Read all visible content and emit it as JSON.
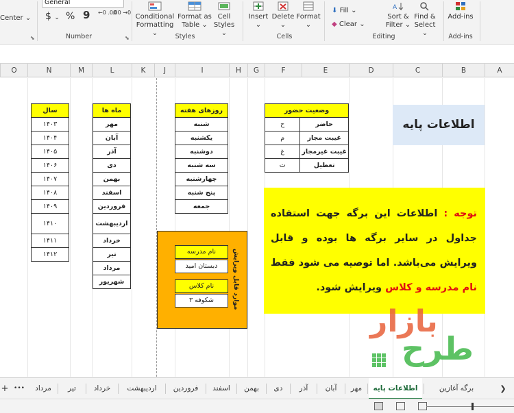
{
  "ribbon": {
    "alignment": {
      "merge_label": "Center"
    },
    "number": {
      "format_value": "General",
      "currency_symbol": "$",
      "percent_symbol": "%",
      "comma_symbol": "9",
      "increase_decimal": "←0 .00",
      "decrease_decimal": ".00 →0",
      "group_label": "Number"
    },
    "styles": {
      "conditional_formatting": "Conditional Formatting",
      "format_as_table": "Format as Table",
      "cell_styles": "Cell Styles",
      "group_label": "Styles"
    },
    "cells": {
      "insert": "Insert",
      "delete": "Delete",
      "format": "Format",
      "group_label": "Cells"
    },
    "editing": {
      "fill": "Fill",
      "clear": "Clear",
      "sort_filter": "Sort & Filter",
      "find_select": "Find & Select",
      "group_label": "Editing"
    },
    "addins": {
      "addins": "Add-ins",
      "group_label": "Add-ins"
    }
  },
  "columns": [
    "O",
    "N",
    "M",
    "L",
    "K",
    "J",
    "I",
    "H",
    "G",
    "F",
    "E",
    "D",
    "C",
    "B",
    "A"
  ],
  "sheet": {
    "title": "اطلاعات پایه",
    "years": {
      "header": "سال",
      "rows": [
        "۱۴۰۳",
        "۱۴۰۴",
        "۱۴۰۵",
        "۱۴۰۶",
        "۱۴۰۷",
        "۱۴۰۸",
        "۱۴۰۹",
        "۱۴۱۰",
        "۱۴۱۱",
        "۱۴۱۲"
      ]
    },
    "months": {
      "header": "ماه ها",
      "rows": [
        "مهر",
        "آبان",
        "آذر",
        "دی",
        "بهمن",
        "اسفند",
        "فروردین",
        "اردیبهشت",
        "خرداد",
        "تیر",
        "مرداد",
        "شهریور"
      ]
    },
    "weekdays": {
      "header": "روزهای هفته",
      "rows": [
        "شنبه",
        "یکشنبه",
        "دوشنبه",
        "سه شنبه",
        "چهارشنبه",
        "پنج شنبه",
        "جمعه"
      ]
    },
    "attendance": {
      "header": "وضعیت حضور",
      "rows": [
        {
          "status": "حاضر",
          "code": "ح"
        },
        {
          "status": "غیبت مجاز",
          "code": "م"
        },
        {
          "status": "غیبت غیرمجاز",
          "code": "غ"
        },
        {
          "status": "تعطیل",
          "code": "ت"
        }
      ]
    },
    "note": {
      "prefix": "توجه :",
      "text1": " اطلاعات این برگه جهت استفاده جداول در سایر برگه ها بوده و قابل ویرایش می‌باشد. اما توصیه می شود فقط ",
      "highlight": "نام مدرسه و کلاس",
      "text2": " ویرایش شود."
    },
    "editable": {
      "vertical_label": "موارد قابل ویرایش",
      "school_label": "نام مدرسه",
      "school_value": "دبستان امید",
      "class_label": "نام کلاس",
      "class_value": "شکوفه ۳"
    },
    "watermark": {
      "line1": "بازار",
      "line2": "طرح"
    }
  },
  "tabs": [
    {
      "label": "برگه آغازین",
      "active": false
    },
    {
      "label": "اطلاعات پایه",
      "active": true
    },
    {
      "label": "مهر",
      "active": false
    },
    {
      "label": "آبان",
      "active": false
    },
    {
      "label": "آذر",
      "active": false
    },
    {
      "label": "دی",
      "active": false
    },
    {
      "label": "بهمن",
      "active": false
    },
    {
      "label": "اسفند",
      "active": false
    },
    {
      "label": "فروردین",
      "active": false
    },
    {
      "label": "اردیبهشت",
      "active": false
    },
    {
      "label": "خرداد",
      "active": false
    },
    {
      "label": "تیر",
      "active": false
    },
    {
      "label": "مرداد",
      "active": false
    }
  ],
  "tabbar": {
    "more": "•••",
    "add": "+",
    "scroll_left": "❮"
  },
  "colors": {
    "yellow": "#ffff00",
    "orange": "#ffb000",
    "title_bg": "#dde9f7",
    "accent_green": "#1e7a3e",
    "red": "#e01010"
  }
}
